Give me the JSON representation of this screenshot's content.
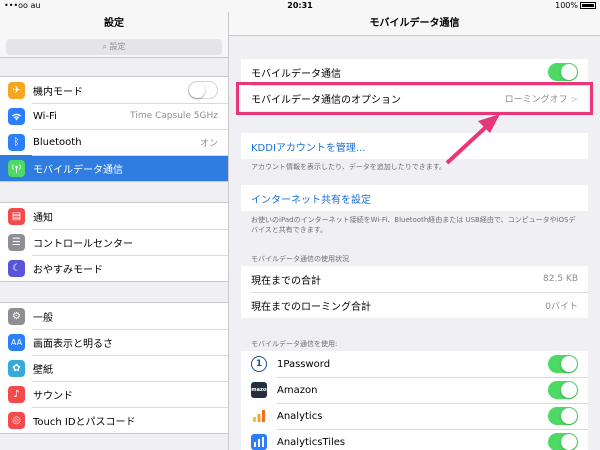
{
  "status_bar": {
    "carrier": "•••oo au",
    "time": "20:31",
    "battery": "100%"
  },
  "left": {
    "title": "設定",
    "search_placeholder": "設定",
    "group1": [
      {
        "label": "機内モード",
        "icon": "airplane-icon",
        "color": "#f5a623",
        "control": "toggle-off"
      },
      {
        "label": "Wi-Fi",
        "icon": "wifi-icon",
        "color": "#2d7ff9",
        "value": "Time Capsule 5GHz"
      },
      {
        "label": "Bluetooth",
        "icon": "bluetooth-icon",
        "color": "#2d7ff9",
        "value": "オン"
      },
      {
        "label": "モバイルデータ通信",
        "icon": "antenna-icon",
        "color": "#4cd964",
        "selected": true
      }
    ],
    "group2": [
      {
        "label": "通知",
        "icon": "notification-icon",
        "color": "#f34b4b"
      },
      {
        "label": "コントロールセンター",
        "icon": "control-center-icon",
        "color": "#8e8e93"
      },
      {
        "label": "おやすみモード",
        "icon": "moon-icon",
        "color": "#5856d6"
      }
    ],
    "group3": [
      {
        "label": "一般",
        "icon": "gear-icon",
        "color": "#8e8e93"
      },
      {
        "label": "画面表示と明るさ",
        "icon": "brightness-icon",
        "color": "#2d7ff9"
      },
      {
        "label": "壁紙",
        "icon": "wallpaper-icon",
        "color": "#36aadc"
      },
      {
        "label": "サウンド",
        "icon": "sound-icon",
        "color": "#f34b4b"
      },
      {
        "label": "Touch IDとパスコード",
        "icon": "fingerprint-icon",
        "color": "#f34b4b"
      }
    ]
  },
  "right": {
    "title": "モバイルデータ通信",
    "cellular_label": "モバイルデータ通信",
    "options_label": "モバイルデータ通信のオプション",
    "options_value": "ローミングオフ",
    "kddi_link": "KDDIアカウントを管理...",
    "kddi_note": "アカウント情報を表示したり、データを追加したりできます。",
    "hotspot_label": "インターネット共有を設定",
    "hotspot_note": "お使いのiPadのインターネット接続をWi-Fi、Bluetooth経由または USB経由で、コンピュータやiOSデバイスと共有できます。",
    "usage_caption": "モバイルデータ通信の使用状況",
    "usage_total_label": "現在までの合計",
    "usage_total_value": "82.5 KB",
    "roaming_total_label": "現在までのローミング合計",
    "roaming_total_value": "0バイト",
    "apps_caption": "モバイルデータ通信を使用:",
    "apps": [
      {
        "name": "1Password",
        "icon": "1password-icon",
        "color": "#1b4d8f"
      },
      {
        "name": "Amazon",
        "icon": "amazon-icon",
        "color": "#232f3e"
      },
      {
        "name": "Analytics",
        "icon": "analytics-icon",
        "color": "#f5a623"
      },
      {
        "name": "AnalyticsTiles",
        "icon": "analytics-tiles-icon",
        "color": "#2d7ff9"
      }
    ]
  }
}
